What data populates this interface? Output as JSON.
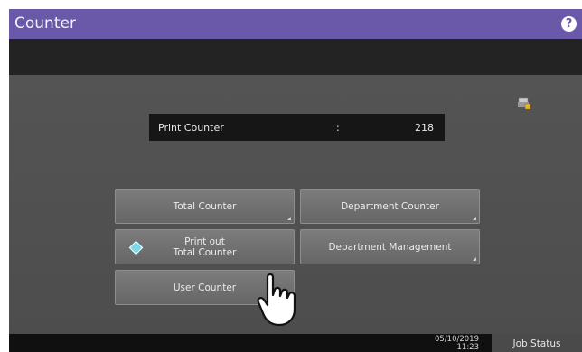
{
  "header": {
    "title": "Counter",
    "help_icon": "question-circle-icon",
    "help_label": "?"
  },
  "counter_display": {
    "label": "Print Counter",
    "separator": ":",
    "value": "218"
  },
  "buttons": {
    "total_counter": "Total Counter",
    "department_counter": "Department Counter",
    "print_out_line1": "Print out",
    "print_out_line2": "Total Counter",
    "department_management": "Department Management",
    "user_counter": "User Counter"
  },
  "footer": {
    "date": "05/10/2019",
    "time": "11:23",
    "job_status": "Job Status"
  },
  "colors": {
    "accent": "#6a58a8",
    "panel": "#545454",
    "button": "#737373"
  }
}
